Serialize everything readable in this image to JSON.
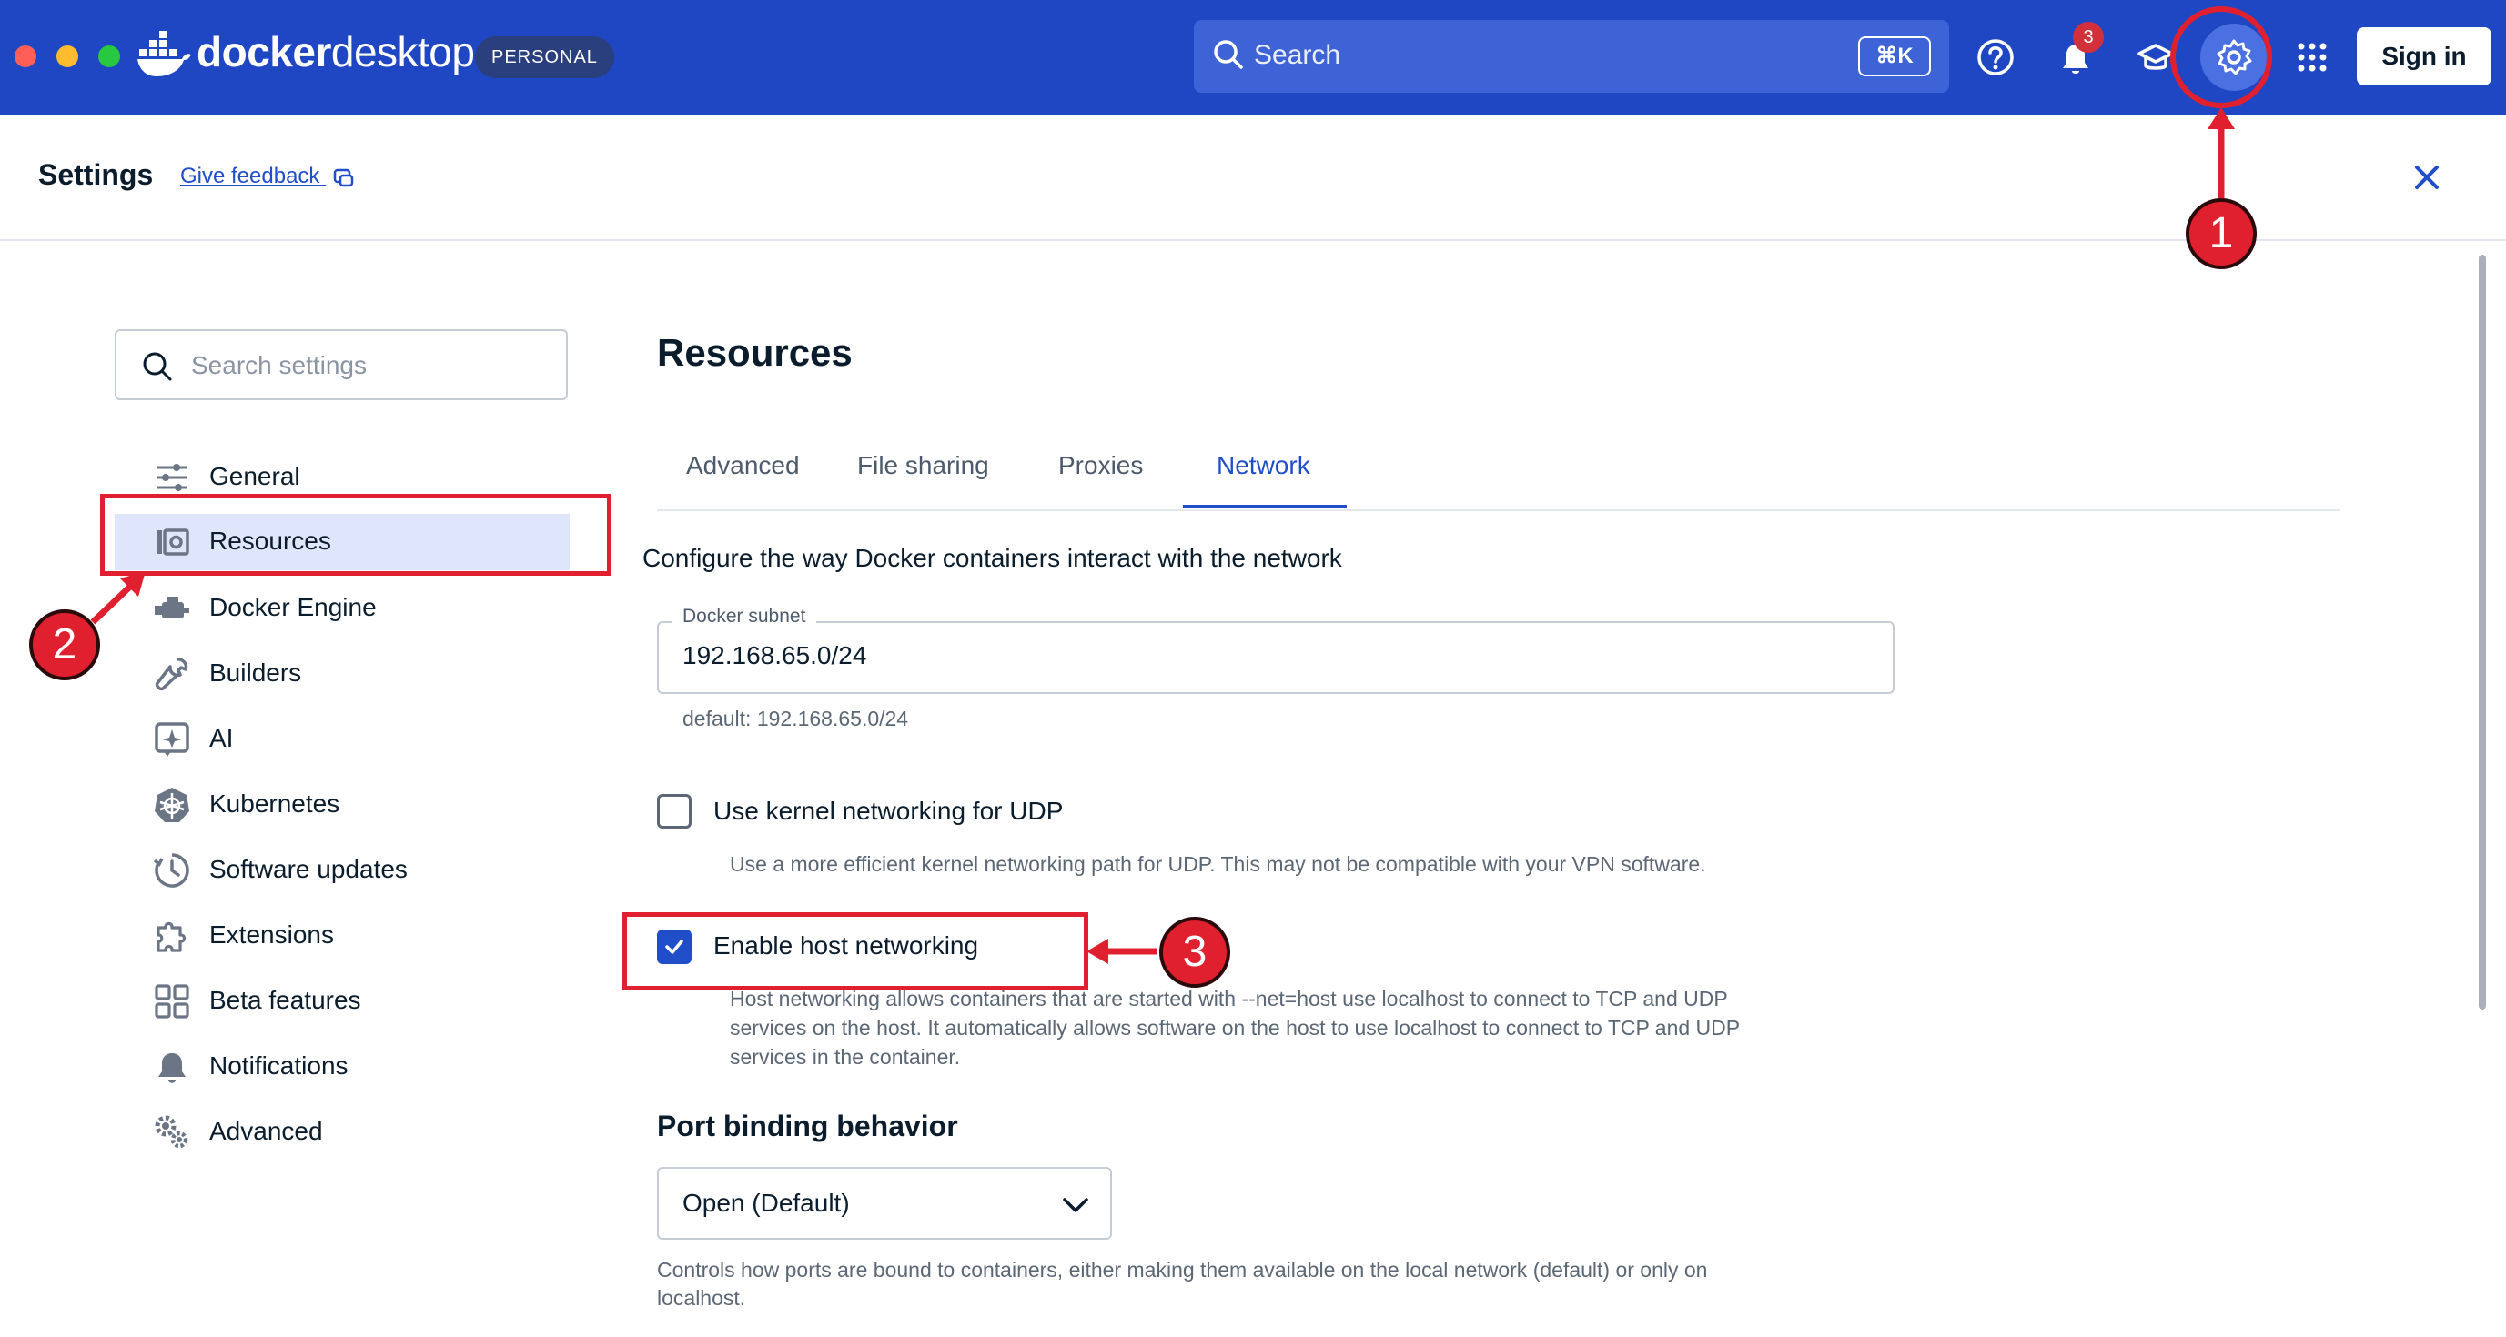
{
  "app": {
    "name_bold": "docker",
    "name_light": "desktop",
    "plan": "PERSONAL"
  },
  "topbar": {
    "search_label": "Search",
    "shortcut": "⌘K",
    "notification_count": "3",
    "signin_label": "Sign in"
  },
  "header": {
    "title": "Settings",
    "feedback": "Give feedback"
  },
  "sidebar": {
    "search_placeholder": "Search settings",
    "items": [
      {
        "label": "General",
        "icon": "sliders-icon"
      },
      {
        "label": "Resources",
        "icon": "resources-icon",
        "active": true
      },
      {
        "label": "Docker Engine",
        "icon": "engine-icon"
      },
      {
        "label": "Builders",
        "icon": "wrench-icon"
      },
      {
        "label": "AI",
        "icon": "ai-icon"
      },
      {
        "label": "Kubernetes",
        "icon": "helm-icon"
      },
      {
        "label": "Software updates",
        "icon": "clock-icon"
      },
      {
        "label": "Extensions",
        "icon": "puzzle-icon"
      },
      {
        "label": "Beta features",
        "icon": "grid-icon"
      },
      {
        "label": "Notifications",
        "icon": "bell-icon"
      },
      {
        "label": "Advanced",
        "icon": "gears-icon"
      }
    ]
  },
  "main": {
    "title": "Resources",
    "tabs": [
      "Advanced",
      "File sharing",
      "Proxies",
      "Network"
    ],
    "active_tab": "Network",
    "description": "Configure the way Docker containers interact with the network",
    "subnet": {
      "label": "Docker subnet",
      "value": "192.168.65.0/24",
      "helper": "default: 192.168.65.0/24"
    },
    "udp": {
      "label": "Use kernel networking for UDP",
      "checked": false,
      "helper": "Use a more efficient kernel networking path for UDP. This may not be compatible with your VPN software."
    },
    "host_networking": {
      "label": "Enable host networking",
      "checked": true,
      "helper_lines": [
        "Host networking allows containers that are started with --net=host use localhost to connect to TCP and UDP",
        "services on the host. It automatically allows software on the host to use localhost to connect to TCP and UDP",
        "services in the container."
      ]
    },
    "port_binding": {
      "title": "Port binding behavior",
      "selected": "Open (Default)",
      "helper_lines": [
        "Controls how ports are bound to containers, either making them available on the local network (default) or only on",
        "localhost."
      ]
    }
  },
  "annotations": [
    "1",
    "2",
    "3"
  ],
  "colors": {
    "topbar": "#1f47c4",
    "accent": "#1f4ec8",
    "annotation": "#e0202e"
  }
}
